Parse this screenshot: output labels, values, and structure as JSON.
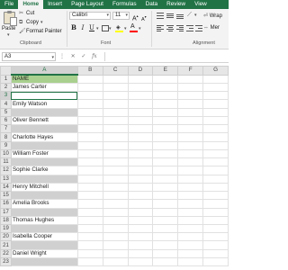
{
  "ribbon": {
    "tabs": [
      "File",
      "Home",
      "Insert",
      "Page Layout",
      "Formulas",
      "Data",
      "Review",
      "View"
    ],
    "active_tab": "Home",
    "clipboard": {
      "paste_label": "Paste",
      "cut_label": "Cut",
      "copy_label": "Copy",
      "format_painter_label": "Format Painter",
      "group_label": "Clipboard"
    },
    "font": {
      "font_name": "Calibri",
      "font_size": "11",
      "group_label": "Font",
      "bold": "B",
      "italic": "I",
      "underline": "U",
      "font_color_glyph": "A",
      "fill_color": "#ffff00",
      "font_color": "#ff0000"
    },
    "alignment": {
      "group_label": "Alignment",
      "wrap_label": "Wrap",
      "merge_label": "Mer"
    }
  },
  "formula_bar": {
    "name_box": "A3",
    "fx_label": "fx",
    "formula": ""
  },
  "sheet": {
    "columns": [
      "A",
      "B",
      "C",
      "D",
      "E",
      "F",
      "G"
    ],
    "selected_column": "A",
    "active_cell_row": 3,
    "rows": [
      {
        "num": "1",
        "value": "NAME",
        "style": "hdr"
      },
      {
        "num": "2",
        "value": "James Carter",
        "style": "plain"
      },
      {
        "num": "3",
        "value": "",
        "style": "active"
      },
      {
        "num": "4",
        "value": "Emily Watson",
        "style": "plain"
      },
      {
        "num": "5",
        "value": "",
        "style": "gray"
      },
      {
        "num": "6",
        "value": "Oliver Bennett",
        "style": "plain"
      },
      {
        "num": "7",
        "value": "",
        "style": "gray"
      },
      {
        "num": "8",
        "value": "Charlotte Hayes",
        "style": "plain"
      },
      {
        "num": "9",
        "value": "",
        "style": "gray"
      },
      {
        "num": "10",
        "value": "William Foster",
        "style": "plain"
      },
      {
        "num": "11",
        "value": "",
        "style": "gray"
      },
      {
        "num": "12",
        "value": "Sophie Clarke",
        "style": "plain"
      },
      {
        "num": "13",
        "value": "",
        "style": "gray"
      },
      {
        "num": "14",
        "value": "Henry Mitchell",
        "style": "plain"
      },
      {
        "num": "15",
        "value": "",
        "style": "gray"
      },
      {
        "num": "16",
        "value": "Amelia Brooks",
        "style": "plain"
      },
      {
        "num": "17",
        "value": "",
        "style": "gray"
      },
      {
        "num": "18",
        "value": "Thomas Hughes",
        "style": "plain"
      },
      {
        "num": "19",
        "value": "",
        "style": "gray"
      },
      {
        "num": "20",
        "value": "Isabella Cooper",
        "style": "plain"
      },
      {
        "num": "21",
        "value": "",
        "style": "gray"
      },
      {
        "num": "22",
        "value": "Daniel Wright",
        "style": "plain"
      },
      {
        "num": "23",
        "value": "",
        "style": "gray"
      }
    ]
  },
  "colors": {
    "accent": "#217346",
    "header_fill": "#a9d08e",
    "blank_row_fill": "#d0d0d0"
  }
}
